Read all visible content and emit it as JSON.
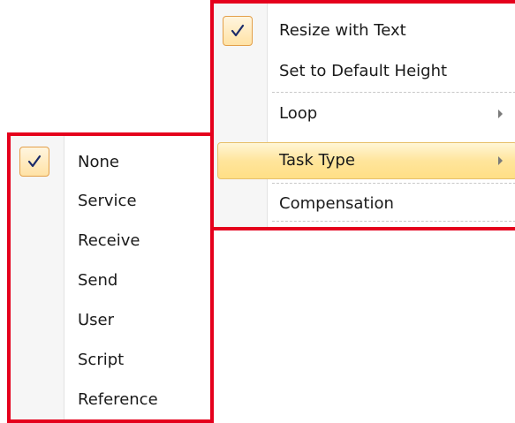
{
  "context_menu": {
    "items": [
      {
        "label": "Resize with Text",
        "checked": true,
        "submenu": false
      },
      {
        "label": "Set to Default Height",
        "checked": false,
        "submenu": false
      },
      {
        "label": "Loop",
        "checked": false,
        "submenu": true
      },
      {
        "label": "Task Type",
        "checked": false,
        "submenu": true,
        "highlighted": true
      },
      {
        "label": "Compensation",
        "checked": false,
        "submenu": false
      }
    ]
  },
  "task_type_submenu": {
    "items": [
      {
        "label": "None",
        "checked": true
      },
      {
        "label": "Service",
        "checked": false
      },
      {
        "label": "Receive",
        "checked": false
      },
      {
        "label": "Send",
        "checked": false
      },
      {
        "label": "User",
        "checked": false
      },
      {
        "label": "Script",
        "checked": false
      },
      {
        "label": "Reference",
        "checked": false
      }
    ]
  },
  "icons": {
    "check": "check-icon",
    "submenu_arrow": "submenu-arrow-icon"
  },
  "check_glyph": "✓",
  "colors": {
    "annotation_border": "#e5001c",
    "highlight": "#ffe59c",
    "check_border": "#e3a04a"
  }
}
